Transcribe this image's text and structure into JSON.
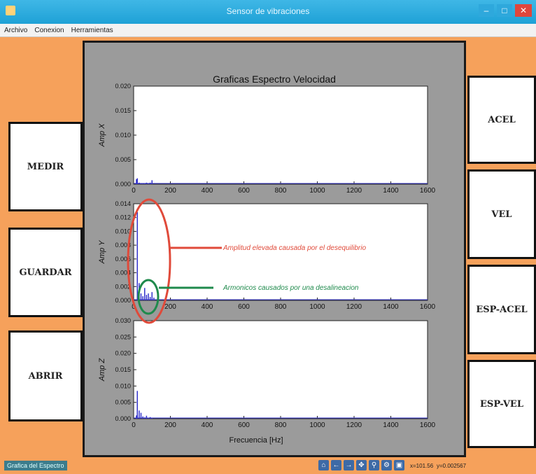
{
  "window": {
    "title": "Sensor de vibraciones"
  },
  "menu": [
    "Archivo",
    "Conexion",
    "Herramientas"
  ],
  "left_buttons": [
    "MEDIR",
    "GUARDAR",
    "ABRIR"
  ],
  "right_buttons": [
    "ACEL",
    "VEL",
    "ESP-ACEL",
    "ESP-VEL"
  ],
  "chart": {
    "title": "Graficas Espectro Velocidad",
    "xlabel": "Frecuencia [Hz]",
    "xticks": [
      "0",
      "200",
      "400",
      "600",
      "800",
      "1000",
      "1200",
      "1400",
      "1600"
    ],
    "xlim": [
      0,
      1600
    ]
  },
  "chart_data": [
    {
      "type": "line",
      "ylabel": "Amp X",
      "ylim": [
        0,
        0.02
      ],
      "yticks": [
        "0.000",
        "0.005",
        "0.010",
        "0.015",
        "0.020"
      ],
      "x": [
        15,
        20,
        30,
        40,
        50,
        60,
        70,
        80,
        90,
        100
      ],
      "y": [
        0.001,
        0.0012,
        0.0003,
        0.0002,
        0.0002,
        0.0001,
        0.0003,
        0.0002,
        0.0003,
        0.0008
      ]
    },
    {
      "type": "line",
      "ylabel": "Amp Y",
      "ylim": [
        0,
        0.014
      ],
      "yticks": [
        "0.000",
        "0.002",
        "0.004",
        "0.006",
        "0.008",
        "0.010",
        "0.012",
        "0.014"
      ],
      "x": [
        20,
        30,
        40,
        50,
        60,
        70,
        80,
        90,
        100,
        110
      ],
      "y": [
        0.0128,
        0.0025,
        0.001,
        0.0006,
        0.0018,
        0.0008,
        0.001,
        0.0005,
        0.0012,
        0.0004
      ]
    },
    {
      "type": "line",
      "ylabel": "Amp Z",
      "ylim": [
        0,
        0.03
      ],
      "yticks": [
        "0.000",
        "0.005",
        "0.010",
        "0.015",
        "0.020",
        "0.025",
        "0.030"
      ],
      "x": [
        15,
        20,
        30,
        40,
        50,
        60,
        70,
        80,
        90,
        100
      ],
      "y": [
        0.001,
        0.0085,
        0.0025,
        0.0018,
        0.0007,
        0.0004,
        0.0009,
        0.0003,
        0.0005,
        0.0002
      ]
    }
  ],
  "annotations": {
    "red": "Amplitud elevada causada por el desequilibrio",
    "green": "Armonicos causados por una desalineacion",
    "red_color": "#e04a3a",
    "green_color": "#1f8a4c"
  },
  "status": {
    "label": "Grafica del Espectro",
    "coords_x": "x=101.56",
    "coords_y": "y=0.002567"
  },
  "colors": {
    "background": "#f6a15b",
    "panel": "#9b9b9b",
    "line": "#3333cc"
  }
}
